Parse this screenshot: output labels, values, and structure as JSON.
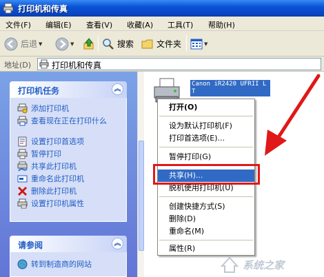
{
  "window": {
    "title": "打印机和传真"
  },
  "menu": [
    "文件(F)",
    "编辑(E)",
    "查看(V)",
    "收藏(A)",
    "工具(T)",
    "帮助(H)"
  ],
  "toolbar": {
    "back": "后退",
    "search": "搜索",
    "folders": "文件夹"
  },
  "address": {
    "label": "地址(D)",
    "value": "打印机和传真"
  },
  "printer_tasks": {
    "title": "打印机任务",
    "items": [
      {
        "label": "添加打印机",
        "icon": "add-printer-icon"
      },
      {
        "label": "查看现在正在打印什么",
        "icon": "view-queue-icon"
      },
      {
        "label": "设置打印首选项",
        "icon": "printer-prefs-icon"
      },
      {
        "label": "暂停打印",
        "icon": "pause-printer-icon"
      },
      {
        "label": "共享此打印机",
        "icon": "share-printer-icon"
      },
      {
        "label": "重命名此打印机",
        "icon": "rename-printer-icon"
      },
      {
        "label": "删除此打印机",
        "icon": "delete-icon"
      },
      {
        "label": "设置打印机属性",
        "icon": "printer-properties-icon"
      }
    ]
  },
  "see_also": {
    "title": "请参阅",
    "items": [
      {
        "label": "转到制造商的网站",
        "icon": "globe-icon"
      }
    ]
  },
  "printer": {
    "name": "Canon iR2420 UFRII LT"
  },
  "context_menu": {
    "open": "打开(O)",
    "set_default": "设为默认打印机(F)",
    "preferences": "打印首选项(E)...",
    "pause": "暂停打印(G)",
    "share": "共享(H)...",
    "offline": "脱机使用打印机(U)",
    "shortcut": "创建快捷方式(S)",
    "delete": "删除(D)",
    "rename": "重命名(M)",
    "properties": "属性(R)"
  },
  "watermark": {
    "text": "系统之家"
  },
  "colors": {
    "titlebar": "#0a54d6",
    "highlight": "#316ac5",
    "annotation": "#e01818",
    "task_link": "#215dc6"
  }
}
